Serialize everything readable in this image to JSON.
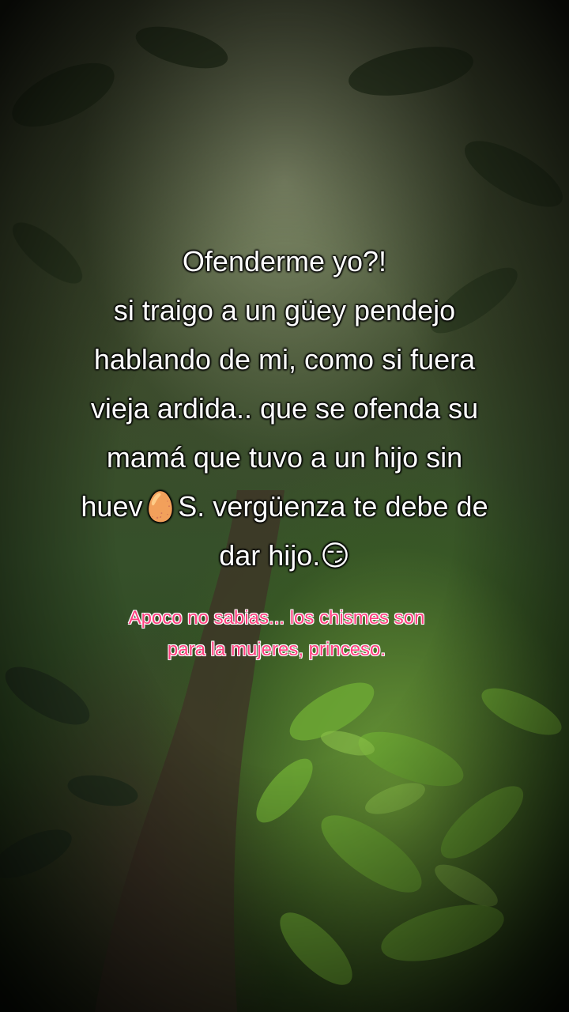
{
  "caption": {
    "text": "Ofenderme yo?!\nsi traigo a un güey pendejo\nhablando de mi, como si fuera\nvieja ardida.. que se ofenda su\nmamá  que tuvo a un hijo sin\nhuev🥚S.  vergüenza te debe de\ndar hijo.😏"
  },
  "subcaption": {
    "text": "Apoco no sabias... los chismes son\npara la mujeres, princeso."
  },
  "background": {
    "subject": "forest path with green leafy plants",
    "colors": {
      "foliage": "#5f9a2c",
      "path": "#4a3a2e",
      "vignette": "#000000"
    }
  }
}
